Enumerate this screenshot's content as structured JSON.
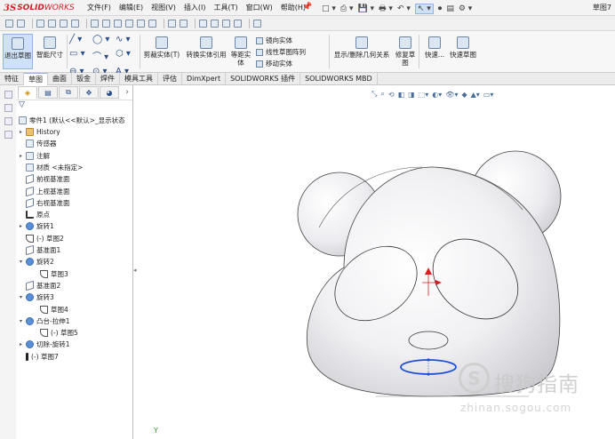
{
  "app": {
    "logo_prefix": "3S",
    "logo_solid": "SOLID",
    "logo_works": "WORKS",
    "doc_title": "草图7"
  },
  "menus": [
    "文件(F)",
    "编辑(E)",
    "视图(V)",
    "插入(I)",
    "工具(T)",
    "窗口(W)",
    "帮助(H)"
  ],
  "quick_tools": [
    "□ ▾",
    "⎙ ▾",
    "💾 ▾",
    "🖶 ▾",
    "↶ ▾",
    "↖ ▾",
    "⏺",
    "▤",
    "⚙ ▾"
  ],
  "command_manager": {
    "exit_sketch": "退出草图",
    "smart_dimension": "智能尺寸",
    "trim": "剪裁实体(T)",
    "convert": "转换实体引用",
    "offset": "等距实体",
    "mirror": "镜向实体",
    "linear_pattern": "线性草图阵列",
    "move": "移动实体",
    "relations": "显示/删除几何关系",
    "repair": "修复草图",
    "quick_snaps": "快速...",
    "rapid_sketch": "快速草图"
  },
  "tabs": [
    "特征",
    "草图",
    "曲面",
    "钣金",
    "焊件",
    "模具工具",
    "评估",
    "DimXpert",
    "SOLIDWORKS 插件",
    "SOLIDWORKS MBD"
  ],
  "active_tab": 1,
  "tree": {
    "root": "零件1 (默认<<默认>_显示状态",
    "items": [
      {
        "label": "History",
        "expand": "▸",
        "indent": 1,
        "icon": "folder"
      },
      {
        "label": "传感器",
        "expand": "",
        "indent": 1,
        "icon": "box"
      },
      {
        "label": "注解",
        "expand": "▸",
        "indent": 1,
        "icon": "box"
      },
      {
        "label": "材质 <未指定>",
        "expand": "",
        "indent": 1,
        "icon": "box"
      },
      {
        "label": "前视基准面",
        "expand": "",
        "indent": 1,
        "icon": "plane"
      },
      {
        "label": "上视基准面",
        "expand": "",
        "indent": 1,
        "icon": "plane"
      },
      {
        "label": "右视基准面",
        "expand": "",
        "indent": 1,
        "icon": "plane"
      },
      {
        "label": "原点",
        "expand": "",
        "indent": 1,
        "icon": "origin"
      },
      {
        "label": "旋转1",
        "expand": "▸",
        "indent": 1,
        "icon": "blue"
      },
      {
        "label": "(-) 草图2",
        "expand": "",
        "indent": 1,
        "icon": "sketch"
      },
      {
        "label": "基准面1",
        "expand": "",
        "indent": 1,
        "icon": "plane"
      },
      {
        "label": "旋转2",
        "expand": "▾",
        "indent": 1,
        "icon": "blue"
      },
      {
        "label": "草图3",
        "expand": "",
        "indent": 2,
        "icon": "sketch"
      },
      {
        "label": "基准面2",
        "expand": "",
        "indent": 1,
        "icon": "plane"
      },
      {
        "label": "旋转3",
        "expand": "▾",
        "indent": 1,
        "icon": "blue"
      },
      {
        "label": "草图4",
        "expand": "",
        "indent": 2,
        "icon": "sketch"
      },
      {
        "label": "凸台-拉伸1",
        "expand": "▾",
        "indent": 1,
        "icon": "blue"
      },
      {
        "label": "(-) 草图5",
        "expand": "",
        "indent": 2,
        "icon": "sketch"
      },
      {
        "label": "切除-旋转1",
        "expand": "▸",
        "indent": 1,
        "icon": "blue"
      },
      {
        "label": "(-) 草图7",
        "expand": "",
        "indent": 1,
        "icon": "rebuild"
      }
    ]
  },
  "watermark": {
    "circle": "S",
    "main": "搜狗指南",
    "sub": "zhinan.sogou.com"
  },
  "colors": {
    "accent_blue": "#1f4fd6",
    "model_shade": "#e9e9ec"
  }
}
